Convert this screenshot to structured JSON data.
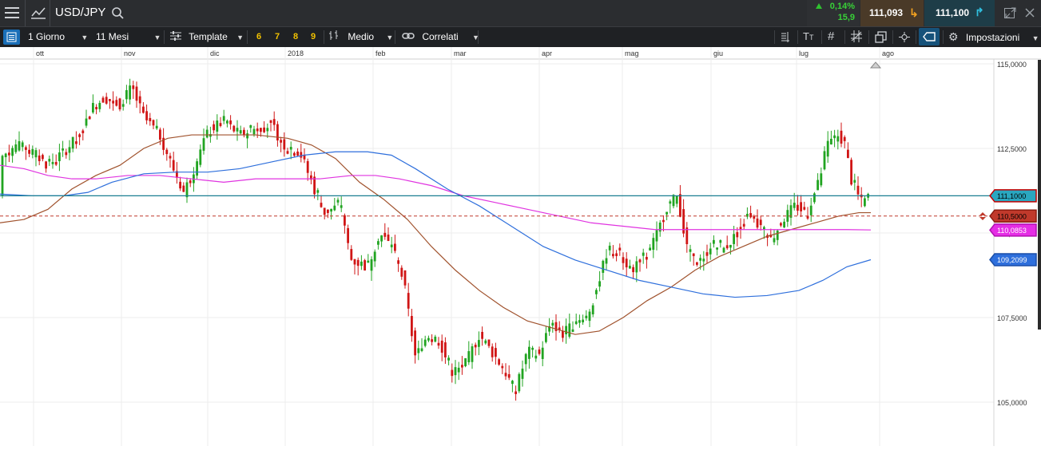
{
  "header": {
    "symbol": "USD/JPY",
    "change_pct": "0,14%",
    "change_abs": "15,9",
    "sell_price": "111,093",
    "buy_price": "111,100"
  },
  "toolbar": {
    "timeframe": "1 Giorno",
    "range": "11 Mesi",
    "template_label": "Template",
    "quick_nums": [
      "6",
      "7",
      "8",
      "9"
    ],
    "price_type": "Medio",
    "correlated_label": "Correlati",
    "settings_label": "Impostazioni"
  },
  "colors": {
    "up": "#21a421",
    "down": "#d01515",
    "price_line": "#1a7f92",
    "ma_brown": "#a0522d",
    "ma_magenta": "#e033e0",
    "ma_blue": "#2e6fdc"
  },
  "chart_data": {
    "type": "candlestick",
    "x_labels": [
      "ott",
      "nov",
      "dic",
      "2018",
      "feb",
      "mar",
      "apr",
      "mag",
      "giu",
      "lug",
      "ago"
    ],
    "y_ticks": [
      "115,0000",
      "112,5000",
      "110,0000",
      "107,5000",
      "105,0000"
    ],
    "ylim": [
      104.7,
      115.2
    ],
    "current_price": 111.1,
    "badges": [
      {
        "name": "price",
        "label": "111,1000",
        "value": 111.1
      },
      {
        "name": "level-dashed",
        "label": "110,5000",
        "value": 110.5
      },
      {
        "name": "ma-magenta",
        "label": "110,0853",
        "value": 110.0853
      },
      {
        "name": "ma-blue",
        "label": "109,2099",
        "value": 109.2099
      }
    ]
  }
}
